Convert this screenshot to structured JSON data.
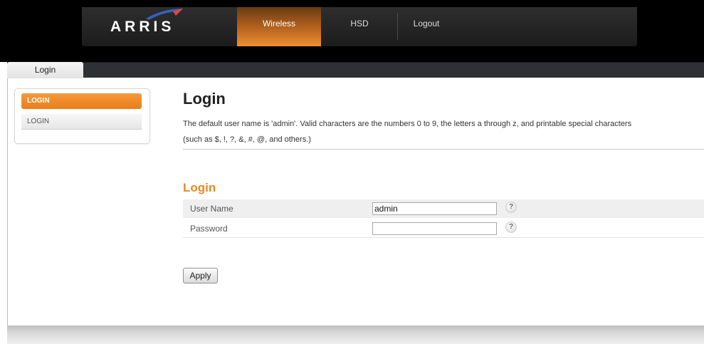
{
  "header": {
    "brand": "ARRIS",
    "nav": [
      "Wireless",
      "HSD",
      "Logout"
    ],
    "active_nav": "Wireless"
  },
  "tabs": [
    "Login"
  ],
  "sidebar": {
    "active_label": "LOGIN",
    "items": [
      "LOGIN"
    ]
  },
  "main": {
    "title": "Login",
    "description_line1": "The default user name is 'admin'. Valid characters are the numbers 0 to 9, the letters a through z, and printable special characters",
    "description_line2": "(such as $, !, ?, &, #, @, and others.)",
    "section_title": "Login",
    "fields": [
      {
        "label": "User Name",
        "value": "admin",
        "help": "?"
      },
      {
        "label": "Password",
        "value": "",
        "help": "?"
      }
    ],
    "apply_label": "Apply"
  },
  "colors": {
    "accent_orange": "#e8891f",
    "header_bg": "#000000",
    "tab_bar_bg": "#2d3136"
  }
}
